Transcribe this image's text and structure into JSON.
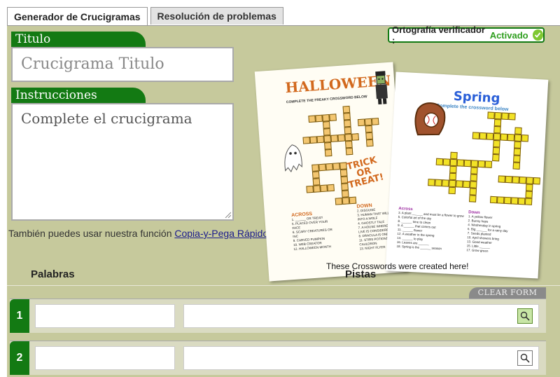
{
  "tabs": [
    {
      "label": "Generador de Crucigramas",
      "active": true
    },
    {
      "label": "Resolución de problemas",
      "active": false
    }
  ],
  "title_section": {
    "label": "Titulo",
    "placeholder": "Crucigrama Titulo"
  },
  "instructions_section": {
    "label": "Instrucciones",
    "value": "Complete el crucigrama"
  },
  "spellcheck": {
    "label": "Ortografía verificador :",
    "status": "Activado"
  },
  "copy_paste": {
    "text": "También puedes usar nuestra función ",
    "link": "Copia-y-Pega Rápido"
  },
  "promo": {
    "caption": "These Crosswords were created here!",
    "card1": {
      "title": "HALLOWEEN",
      "subtitle": "COMPLETE THE FREAKY CROSSWORD BELOW",
      "art_text": [
        "TRICK",
        "OR",
        "TREAT!"
      ],
      "across_heading": "ACROSS",
      "across_clues": [
        "1. ______ OR TREAT!",
        "5. PLACED OVER YOUR",
        "FACE",
        "6. SCARY CREATURES OR",
        "INC",
        "9. CARVED PUMPKIN",
        "10. WEB CREATOR",
        "12. HALLOWEEN MONTH"
      ],
      "down_heading": "DOWN",
      "down_clues": [
        "2. DISGUISE",
        "3. HUMAN THAT WILL TURN",
        "INTO A WOLF",
        "4. GHOSTLY TALE",
        "7. A HOUSE WHERE A",
        "LIVE IS CONSIDERED",
        "8. DRACULA IS ONE",
        "11. STIRS POTIONS IN A",
        "CAULDRON",
        "13. NIGHT FLYER"
      ]
    },
    "card2": {
      "title": "Spring",
      "subtitle": "Complete the crossword below",
      "across_heading": "Across",
      "across_clues": [
        "3. A plant ______ and must be a flower to grow",
        "5. Colorful art of the sky",
        "8. ______ time to clean",
        "9. A ______ that comes out",
        "11. ______ flower",
        "12. A weather in the spring",
        "14. ______ to play",
        "16. Leaves are ______",
        "18. Spring is the ______ season"
      ],
      "down_heading": "Down",
      "down_clues": [
        "1. A yellow flower",
        "2. Bunny hops",
        "4. Wednesday in spring",
        "6. Big ______ for a rainy day",
        "7. Seeds planted",
        "10. April showers bring",
        "13. Good weather",
        "15. Little ______",
        "17. Grow green"
      ]
    }
  },
  "columns": {
    "words": "Palabras",
    "clues": "Pistas"
  },
  "clear_form_label": "CLEAR FORM",
  "rows": [
    {
      "number": "1"
    },
    {
      "number": "2"
    }
  ],
  "colors": {
    "panel": "#c6c99c",
    "accent_green": "#137a13",
    "active_green": "#2e9e1e",
    "halloween_orange": "#d2691e",
    "spring_blue": "#2a5fd8"
  }
}
